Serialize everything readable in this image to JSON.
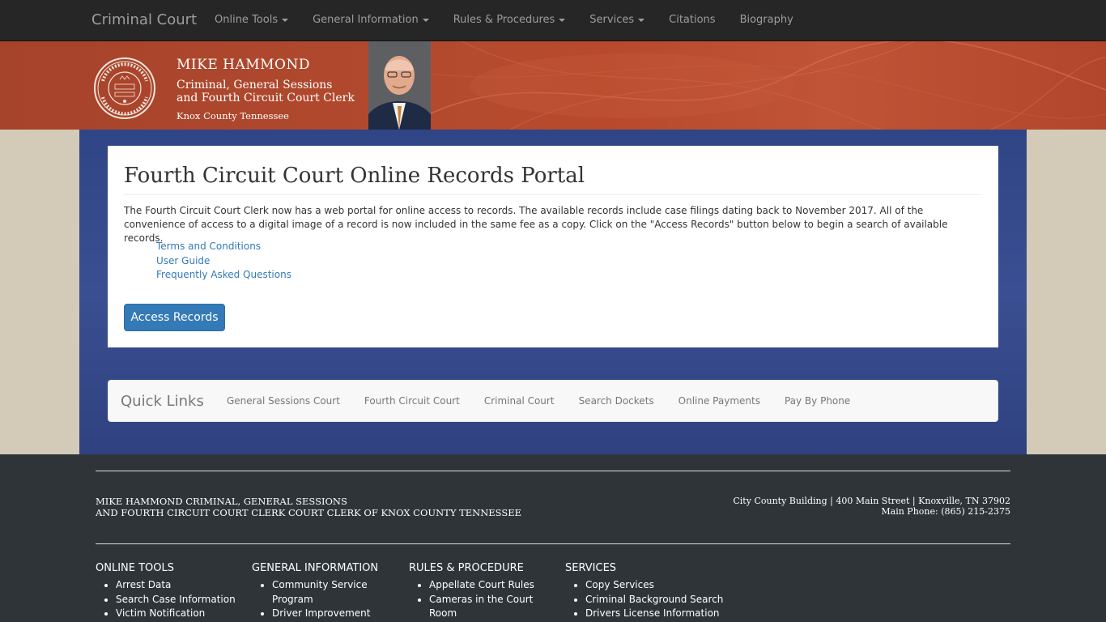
{
  "navbar": {
    "brand": "Criminal Court",
    "items": [
      {
        "label": "Online Tools",
        "dropdown": true
      },
      {
        "label": "General Information",
        "dropdown": true
      },
      {
        "label": "Rules & Procedures",
        "dropdown": true
      },
      {
        "label": "Services",
        "dropdown": true
      },
      {
        "label": "Citations",
        "dropdown": false
      },
      {
        "label": "Biography",
        "dropdown": false
      }
    ]
  },
  "header": {
    "seal_icon": "official-seal-icon",
    "name": "MIKE HAMMOND",
    "title_line1": "Criminal, General Sessions",
    "title_line2": "and Fourth Circuit Court Clerk",
    "county": "Knox County Tennessee"
  },
  "portal": {
    "title": "Fourth Circuit Court Online Records Portal",
    "description": "The Fourth Circuit Court Clerk now has a web portal for online access to records. The available records include case filings dating back to November 2017. All of the convenience of access to a digital image of a record is now included in the same fee as a copy. Click on the \"Access Records\" button below to begin a search of available records.",
    "links": [
      "Terms and Conditions",
      "User Guide",
      "Frequently Asked Questions"
    ],
    "button_label": "Access Records"
  },
  "quick_links": {
    "title": "Quick Links",
    "items": [
      "General Sessions Court",
      "Fourth Circuit Court",
      "Criminal Court",
      "Search Dockets",
      "Online Payments",
      "Pay By Phone"
    ]
  },
  "footer": {
    "org_line1": "MIKE HAMMOND CRIMINAL, GENERAL SESSIONS",
    "org_line2": "AND FOURTH CIRCUIT COURT CLERK COURT CLERK OF KNOX COUNTY TENNESSEE",
    "address": "City County Building | 400 Main Street | Knoxville, TN 37902",
    "phone": "Main Phone: (865) 215-2375",
    "columns": [
      {
        "heading": "ONLINE TOOLS",
        "items": [
          "Arrest Data",
          "Search Case Information",
          "Victim Notification"
        ]
      },
      {
        "heading": "GENERAL INFORMATION",
        "items": [
          "Community Service Program",
          "Driver Improvement"
        ]
      },
      {
        "heading": "RULES & PROCEDURE",
        "items": [
          "Appellate Court Rules",
          "Cameras in the Court Room"
        ]
      },
      {
        "heading": "SERVICES",
        "items": [
          "Copy Services",
          "Criminal Background Search",
          "Drivers License Information"
        ]
      }
    ]
  },
  "colors": {
    "navbar_bg": "#262626",
    "banner": "#b34a2e",
    "main_bg": "#3a4f91",
    "link": "#337ab7",
    "footer_bg": "#2f3438"
  }
}
